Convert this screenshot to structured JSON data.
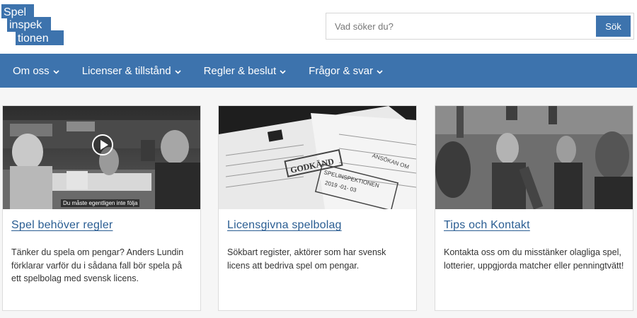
{
  "brand": {
    "logo_lines": [
      "Spel",
      "inspek",
      "tionen"
    ],
    "accent_color": "#3d73ad",
    "link_color": "#2a5d92"
  },
  "search": {
    "placeholder": "Vad söker du?",
    "button_label": "Sök"
  },
  "nav": {
    "items": [
      {
        "label": "Om oss",
        "icon": "chevron-down-icon"
      },
      {
        "label": "Licenser & tillstånd",
        "icon": "chevron-down-icon"
      },
      {
        "label": "Regler & beslut",
        "icon": "chevron-down-icon"
      },
      {
        "label": "Frågor & svar",
        "icon": "chevron-down-icon"
      }
    ]
  },
  "cards": [
    {
      "title": "Spel behöver regler",
      "text": "Tänker du spela om pengar? Anders Lundin förklarar varför du i sådana fall bör spela på ett spelbolag med svensk licens.",
      "image": "video-still-two-people-talking",
      "video_caption": "Du måste egentligen inte följa",
      "icon": "play-icon"
    },
    {
      "title": "Licensgivna spelbolag",
      "text": "Sökbart register, aktörer som har svensk licens att bedriva spel om pengar.",
      "image": "stamped-application-documents",
      "stamp_text": "GODKÄND",
      "doc_heading": "ANSÖKAN OM",
      "doc_stamp": "SPELINSPEKTIONEN",
      "doc_date": "2019 -01- 03"
    },
    {
      "title": "Tips och Kontakt",
      "text": "Kontakta oss om du misstänker olagliga spel, lotterier, uppgjorda matcher eller penningtvätt!",
      "image": "people-at-cafe-table"
    }
  ]
}
